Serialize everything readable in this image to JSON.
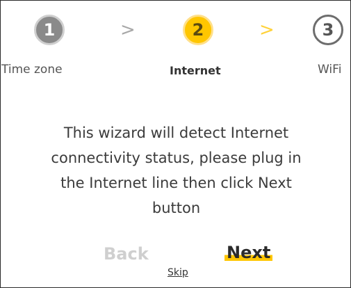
{
  "wizard": {
    "steps": [
      {
        "number": "1",
        "label": "Time zone"
      },
      {
        "number": "2",
        "label": "Internet"
      },
      {
        "number": "3",
        "label": "WiFi"
      }
    ],
    "separator": ">",
    "message": "This wizard will detect Internet connectivity status, please plug in the Internet line then click Next button",
    "back_label": "Back",
    "next_label": "Next",
    "skip_label": "Skip"
  },
  "colors": {
    "active_step": "#ffc600",
    "done_step": "#8a8a8a",
    "disabled_text": "#cfcfcf"
  }
}
